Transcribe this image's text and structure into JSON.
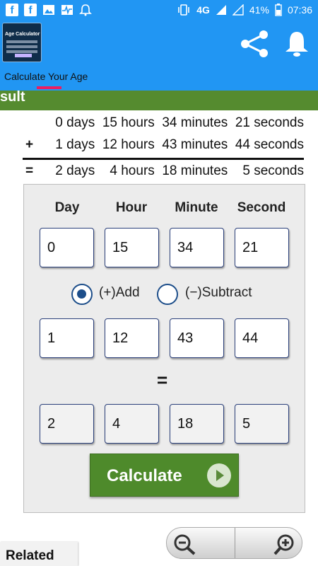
{
  "status": {
    "network": "4G",
    "battery": "41%",
    "time": "07:36",
    "icons": [
      "facebook-icon",
      "facebook-icon",
      "gallery-icon",
      "pulse-icon",
      "alarm-bell-icon",
      "vibrate-icon",
      "signal-icon",
      "no-signal-icon",
      "battery-icon"
    ]
  },
  "app": {
    "logo_text": "Age Calculator",
    "subtitle": "Calculate Your Age",
    "actions": [
      "share-icon",
      "bell-icon"
    ]
  },
  "result": {
    "label": "sult",
    "line1": "0 days  15 hours  34 minutes  21 seconds",
    "line2": "1 days  12 hours  43 minutes  44 seconds",
    "line3": "2 days    4 hours  18 minutes    5 seconds",
    "plus": "+",
    "equals": "="
  },
  "calculator": {
    "headers": [
      "Day",
      "Hour",
      "Minute",
      "Second"
    ],
    "row1": [
      "0",
      "15",
      "34",
      "21"
    ],
    "radio_add": "(+)Add",
    "radio_subtract": "(−)Subtract",
    "selected": "add",
    "row2": [
      "1",
      "12",
      "43",
      "44"
    ],
    "equals": "=",
    "result_row": [
      "2",
      "4",
      "18",
      "5"
    ],
    "button": "Calculate"
  },
  "footer": {
    "related": "Related",
    "zoom_out": "zoom-out-icon",
    "zoom_in": "zoom-in-icon"
  },
  "colors": {
    "primary": "#2196f3",
    "result_bar": "#558b2f",
    "button": "#4e8a2b",
    "tab_indicator": "#e91e63"
  }
}
